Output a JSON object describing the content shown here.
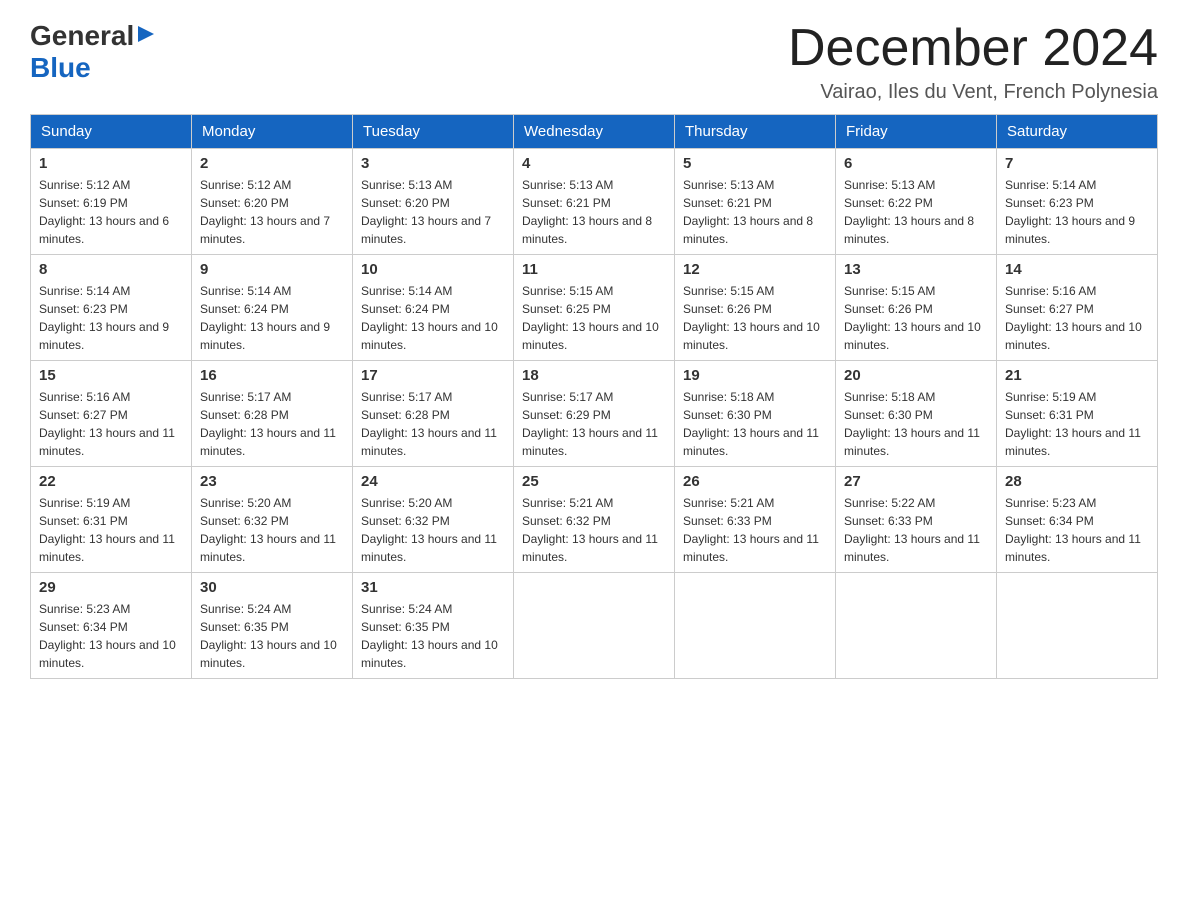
{
  "header": {
    "logo_general": "General",
    "logo_blue": "Blue",
    "month_title": "December 2024",
    "subtitle": "Vairao, Iles du Vent, French Polynesia"
  },
  "days_of_week": [
    "Sunday",
    "Monday",
    "Tuesday",
    "Wednesday",
    "Thursday",
    "Friday",
    "Saturday"
  ],
  "weeks": [
    [
      {
        "day": "1",
        "sunrise": "5:12 AM",
        "sunset": "6:19 PM",
        "daylight": "13 hours and 6 minutes."
      },
      {
        "day": "2",
        "sunrise": "5:12 AM",
        "sunset": "6:20 PM",
        "daylight": "13 hours and 7 minutes."
      },
      {
        "day": "3",
        "sunrise": "5:13 AM",
        "sunset": "6:20 PM",
        "daylight": "13 hours and 7 minutes."
      },
      {
        "day": "4",
        "sunrise": "5:13 AM",
        "sunset": "6:21 PM",
        "daylight": "13 hours and 8 minutes."
      },
      {
        "day": "5",
        "sunrise": "5:13 AM",
        "sunset": "6:21 PM",
        "daylight": "13 hours and 8 minutes."
      },
      {
        "day": "6",
        "sunrise": "5:13 AM",
        "sunset": "6:22 PM",
        "daylight": "13 hours and 8 minutes."
      },
      {
        "day": "7",
        "sunrise": "5:14 AM",
        "sunset": "6:23 PM",
        "daylight": "13 hours and 9 minutes."
      }
    ],
    [
      {
        "day": "8",
        "sunrise": "5:14 AM",
        "sunset": "6:23 PM",
        "daylight": "13 hours and 9 minutes."
      },
      {
        "day": "9",
        "sunrise": "5:14 AM",
        "sunset": "6:24 PM",
        "daylight": "13 hours and 9 minutes."
      },
      {
        "day": "10",
        "sunrise": "5:14 AM",
        "sunset": "6:24 PM",
        "daylight": "13 hours and 10 minutes."
      },
      {
        "day": "11",
        "sunrise": "5:15 AM",
        "sunset": "6:25 PM",
        "daylight": "13 hours and 10 minutes."
      },
      {
        "day": "12",
        "sunrise": "5:15 AM",
        "sunset": "6:26 PM",
        "daylight": "13 hours and 10 minutes."
      },
      {
        "day": "13",
        "sunrise": "5:15 AM",
        "sunset": "6:26 PM",
        "daylight": "13 hours and 10 minutes."
      },
      {
        "day": "14",
        "sunrise": "5:16 AM",
        "sunset": "6:27 PM",
        "daylight": "13 hours and 10 minutes."
      }
    ],
    [
      {
        "day": "15",
        "sunrise": "5:16 AM",
        "sunset": "6:27 PM",
        "daylight": "13 hours and 11 minutes."
      },
      {
        "day": "16",
        "sunrise": "5:17 AM",
        "sunset": "6:28 PM",
        "daylight": "13 hours and 11 minutes."
      },
      {
        "day": "17",
        "sunrise": "5:17 AM",
        "sunset": "6:28 PM",
        "daylight": "13 hours and 11 minutes."
      },
      {
        "day": "18",
        "sunrise": "5:17 AM",
        "sunset": "6:29 PM",
        "daylight": "13 hours and 11 minutes."
      },
      {
        "day": "19",
        "sunrise": "5:18 AM",
        "sunset": "6:30 PM",
        "daylight": "13 hours and 11 minutes."
      },
      {
        "day": "20",
        "sunrise": "5:18 AM",
        "sunset": "6:30 PM",
        "daylight": "13 hours and 11 minutes."
      },
      {
        "day": "21",
        "sunrise": "5:19 AM",
        "sunset": "6:31 PM",
        "daylight": "13 hours and 11 minutes."
      }
    ],
    [
      {
        "day": "22",
        "sunrise": "5:19 AM",
        "sunset": "6:31 PM",
        "daylight": "13 hours and 11 minutes."
      },
      {
        "day": "23",
        "sunrise": "5:20 AM",
        "sunset": "6:32 PM",
        "daylight": "13 hours and 11 minutes."
      },
      {
        "day": "24",
        "sunrise": "5:20 AM",
        "sunset": "6:32 PM",
        "daylight": "13 hours and 11 minutes."
      },
      {
        "day": "25",
        "sunrise": "5:21 AM",
        "sunset": "6:32 PM",
        "daylight": "13 hours and 11 minutes."
      },
      {
        "day": "26",
        "sunrise": "5:21 AM",
        "sunset": "6:33 PM",
        "daylight": "13 hours and 11 minutes."
      },
      {
        "day": "27",
        "sunrise": "5:22 AM",
        "sunset": "6:33 PM",
        "daylight": "13 hours and 11 minutes."
      },
      {
        "day": "28",
        "sunrise": "5:23 AM",
        "sunset": "6:34 PM",
        "daylight": "13 hours and 11 minutes."
      }
    ],
    [
      {
        "day": "29",
        "sunrise": "5:23 AM",
        "sunset": "6:34 PM",
        "daylight": "13 hours and 10 minutes."
      },
      {
        "day": "30",
        "sunrise": "5:24 AM",
        "sunset": "6:35 PM",
        "daylight": "13 hours and 10 minutes."
      },
      {
        "day": "31",
        "sunrise": "5:24 AM",
        "sunset": "6:35 PM",
        "daylight": "13 hours and 10 minutes."
      },
      null,
      null,
      null,
      null
    ]
  ]
}
